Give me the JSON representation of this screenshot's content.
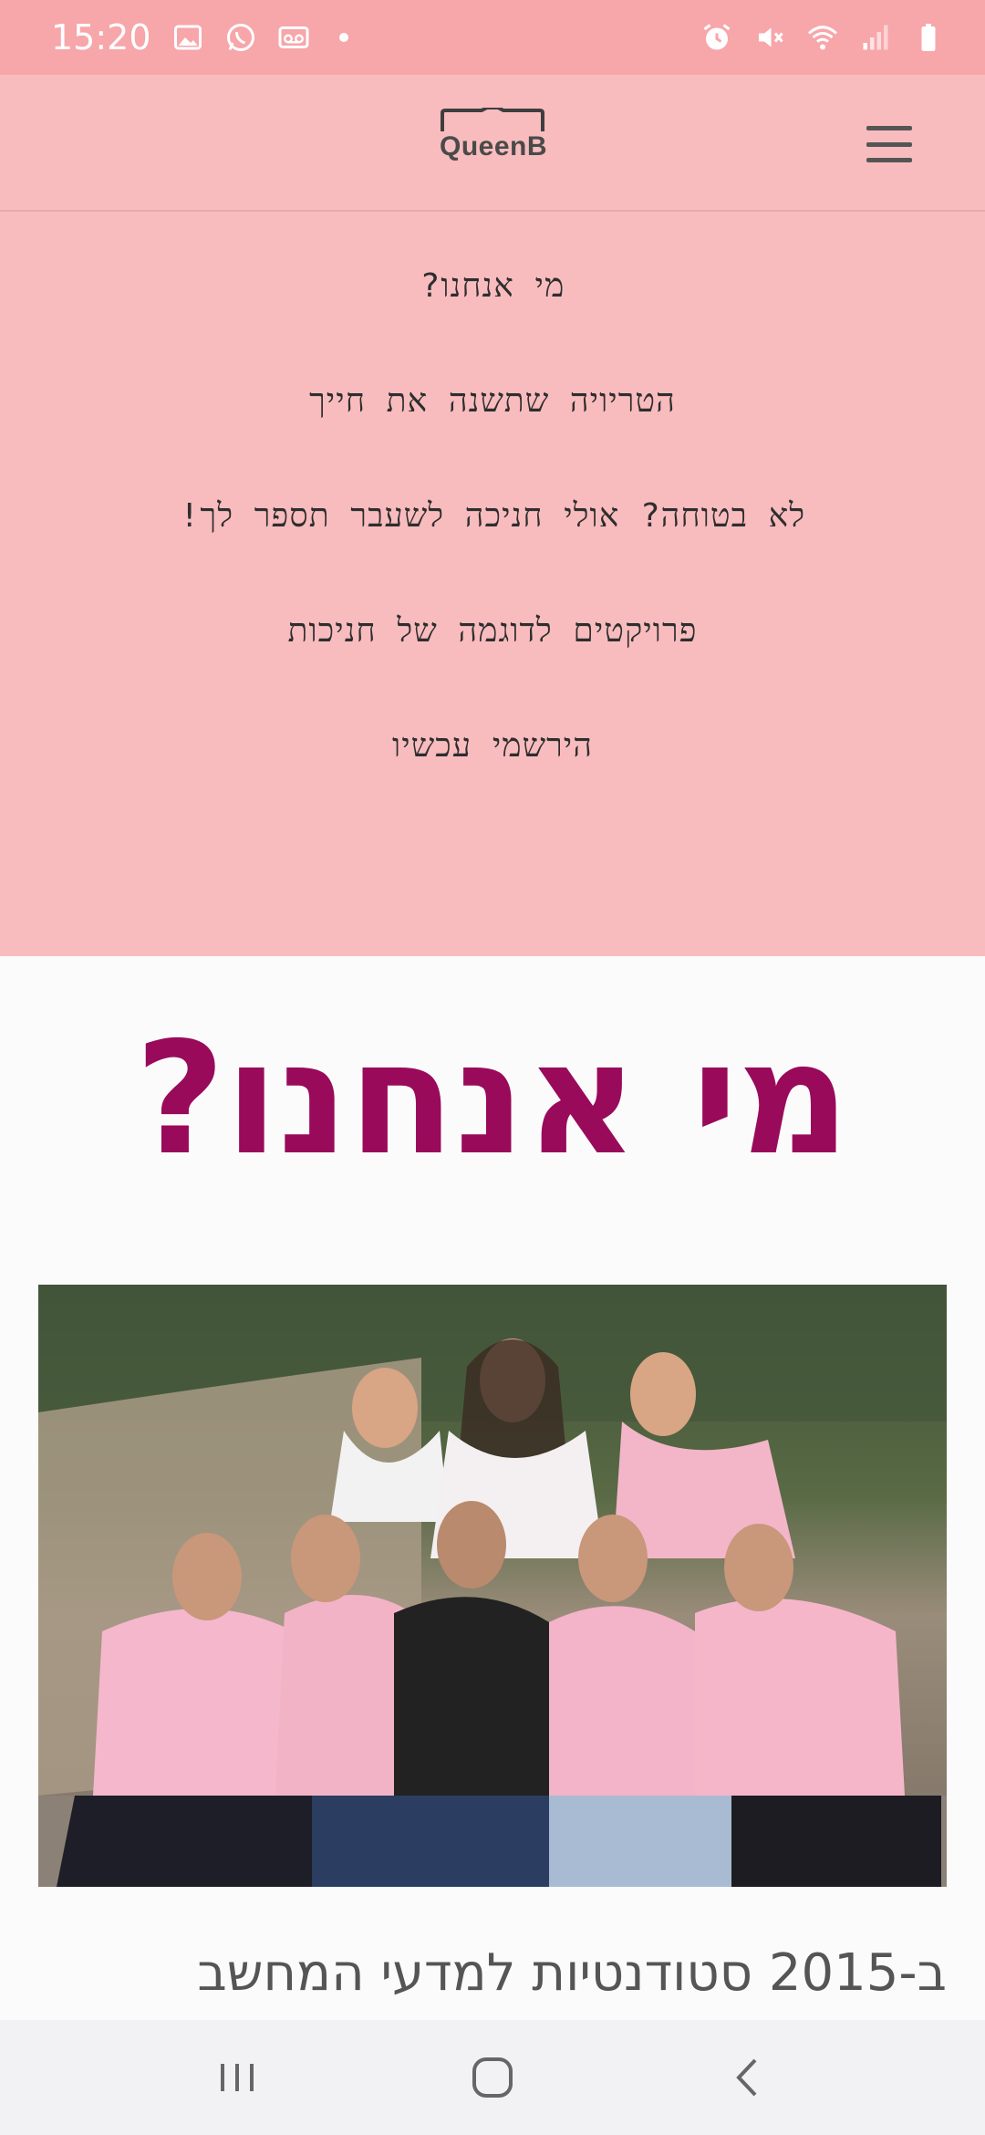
{
  "status_bar": {
    "time": "15:20",
    "left_icons": [
      "image-icon",
      "whatsapp-icon",
      "voicemail-icon"
    ],
    "right_icons": [
      "alarm-icon",
      "mute-icon",
      "wifi-icon",
      "signal-icon",
      "battery-icon"
    ]
  },
  "header": {
    "logo_text": "QueenB",
    "menu_icon": "hamburger-menu-icon"
  },
  "nav_menu": {
    "items": [
      "מי אנחנו?",
      "הטריויה שתשנה את חייך",
      "לא בטוחה? אולי חניכה לשעבר תספר לך!",
      "פרויקטים לדוגמה של חניכות",
      "הירשמי עכשיו"
    ]
  },
  "main": {
    "title": "מי אנחנו?",
    "intro_text": "ב-2015 סטודנטיות למדעי המחשב"
  },
  "colors": {
    "status_bar": "#f7a6aa",
    "header": "#f9bcbe",
    "title": "#990a5b",
    "body_bg": "#fbfbfc"
  },
  "system_nav": {
    "buttons": [
      "recent-apps-icon",
      "home-icon",
      "back-icon"
    ]
  }
}
